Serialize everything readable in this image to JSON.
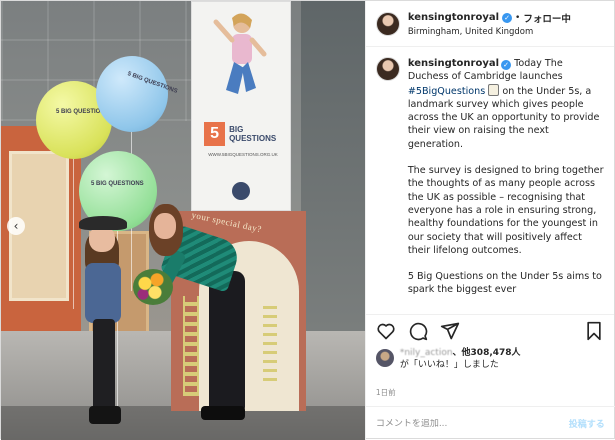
{
  "header": {
    "username": "kensingtonroyal",
    "separator": "•",
    "follow_label": "フォロー中",
    "location": "Birmingham, United Kingdom"
  },
  "photo": {
    "balloon_text_1": "5 BIG QUESTIONS",
    "balloon_text_2": "5 BIG QUESTIONS",
    "balloon_text_3": "5 BIG QUESTIONS",
    "banner_number": "5",
    "banner_title": "BIG QUESTIONS",
    "banner_url": "WWW.5BIGQUESTIONS.ORG.UK",
    "stage_text": "your special day?"
  },
  "caption": {
    "username": "kensingtonroyal",
    "intro": "Today The Duchess of Cambridge launches",
    "hashtag": "#5BigQuestions",
    "intro_rest": "on the Under 5s, a landmark survey which gives people across the UK an opportunity to provide their view on raising the next generation.",
    "paragraph_2": "The survey is designed to bring together the thoughts of as many people across the UK as possible – recognising that everyone has a role in ensuring strong, healthy foundations for the youngest in our society that will positively affect their lifelong outcomes.",
    "paragraph_3": "5 Big Questions on the Under 5s aims to spark the biggest ever"
  },
  "likes": {
    "blurred_user": "*nily_action",
    "others": "、他308,478人",
    "line2": "が「いいね！」しました"
  },
  "timestamp": "1日前",
  "comment": {
    "placeholder": "コメントを追加...",
    "post_label": "投稿する"
  },
  "icons": [
    "heart-icon",
    "comment-icon",
    "share-icon",
    "bookmark-icon",
    "verified-badge-icon",
    "chevron-left-icon"
  ],
  "colors": {
    "hashtag": "#00376b",
    "verified": "#3897f0",
    "post_button": "#b2dffc",
    "muted": "#8e8e8e"
  }
}
